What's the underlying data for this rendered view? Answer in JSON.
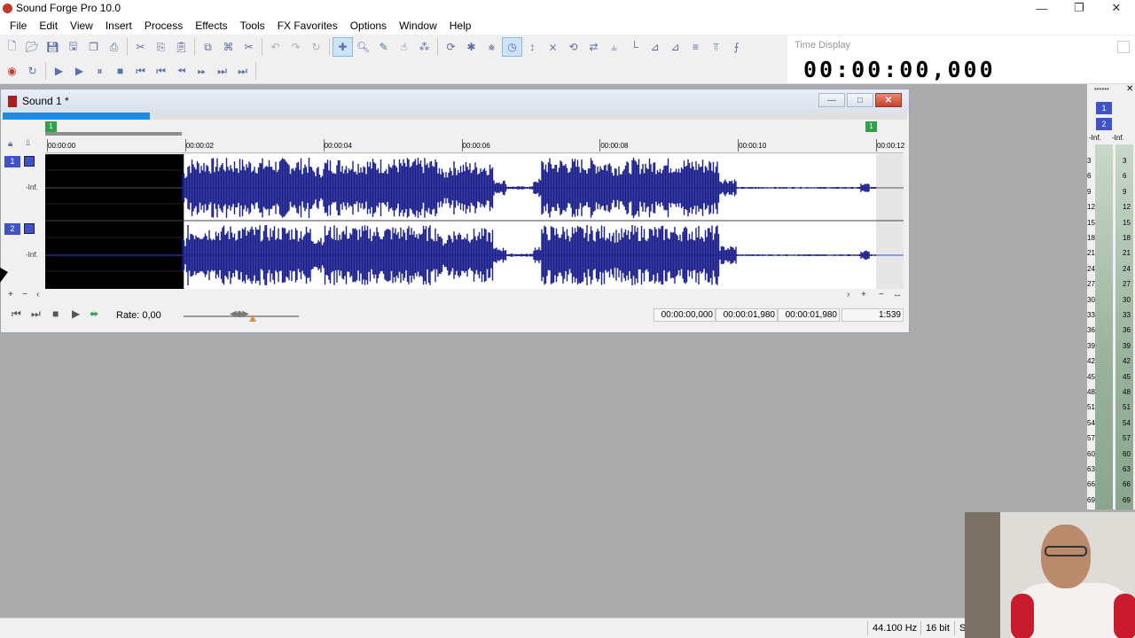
{
  "app": {
    "title": "Sound Forge Pro 10.0",
    "window_controls": [
      "minimize",
      "restore",
      "close"
    ]
  },
  "menu": [
    "File",
    "Edit",
    "View",
    "Insert",
    "Process",
    "Effects",
    "Tools",
    "FX Favorites",
    "Options",
    "Window",
    "Help"
  ],
  "toolbar1_icons": [
    "new-icon",
    "open-icon",
    "save-icon",
    "save-as-icon",
    "render-icon",
    "print-icon",
    "cut-icon",
    "copy-icon",
    "paste-icon",
    "mix-icon",
    "crop-icon",
    "trim-icon",
    "undo-icon",
    "redo-icon",
    "repeat-icon",
    "edit-tool-icon",
    "magnify-tool-icon",
    "pencil-tool-icon",
    "event-tool-icon",
    "envelope-tool-icon",
    "loop-icon",
    "auto-snap-icon",
    "grid-icon",
    "time-icon",
    "normalize-icon",
    "fade-icon",
    "reverse-icon",
    "swap-icon",
    "split-icon",
    "graph-icon",
    "fade-in-icon",
    "fade-out-icon",
    "volume-icon",
    "eq-icon",
    "mixer-icon"
  ],
  "toolbar2_icons": [
    "record-icon",
    "loop-playback-icon",
    "play-all-icon",
    "play-icon",
    "pause-icon",
    "stop-icon",
    "go-to-start-icon",
    "previous-icon",
    "rewind-icon",
    "forward-icon",
    "next-icon",
    "go-to-end-icon"
  ],
  "time_display": {
    "label": "Time Display",
    "value": "00:00:00,000"
  },
  "sound_window": {
    "title": "Sound 1 *",
    "overview_progress": 0.163,
    "marker_start": "1",
    "marker_end": "1",
    "ruler_labels": [
      "00:00:00",
      "00:00:02",
      "00:00:04",
      "00:00:06",
      "00:00:08",
      "00:00:10",
      "00:00:12"
    ],
    "channels": [
      {
        "number": "1",
        "level": "-Inf."
      },
      {
        "number": "2",
        "level": "-Inf."
      }
    ],
    "selection_end_seconds": 1.98,
    "duration_seconds": 12.0,
    "transport": {
      "rate_label": "Rate: 0,00",
      "selection_start": "00:00:00,000",
      "selection_end": "00:00:01,980",
      "selection_length": "00:00:01,980",
      "zoom": "1:539"
    }
  },
  "meters": {
    "channels": [
      "1",
      "2"
    ],
    "levels": [
      "-Inf.",
      "-Inf."
    ],
    "scale": [
      "3",
      "6",
      "9",
      "12",
      "15",
      "18",
      "21",
      "24",
      "27",
      "30",
      "33",
      "36",
      "39",
      "42",
      "45",
      "48",
      "51",
      "54",
      "57",
      "60",
      "63",
      "66",
      "69"
    ]
  },
  "status": {
    "sample_rate": "44.100 Hz",
    "bit_depth": "16 bit",
    "truncated": "S"
  },
  "colors": {
    "waveform": "#1a1f8c",
    "selection_bg": "#000000",
    "channel_badge": "#3f52c7",
    "overview": "#1f8ae0",
    "marker": "#2ea14a"
  }
}
